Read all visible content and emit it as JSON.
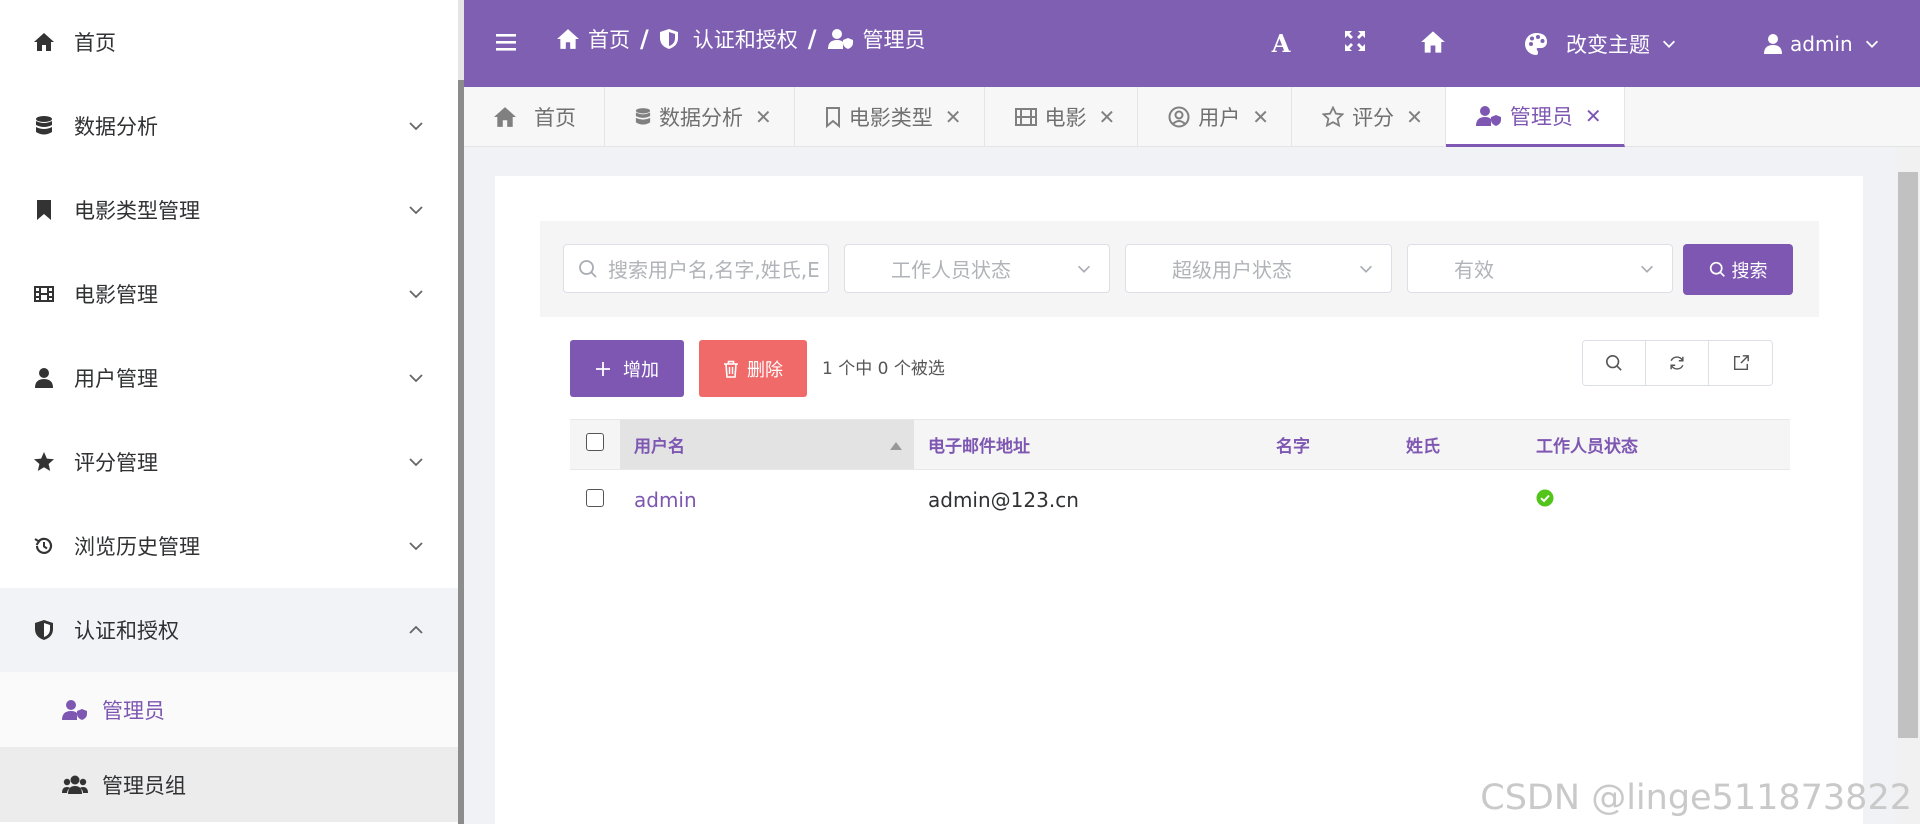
{
  "sidebar": {
    "items": [
      {
        "label": "首页",
        "icon": "home-icon"
      },
      {
        "label": "数据分析",
        "icon": "database-icon"
      },
      {
        "label": "电影类型管理",
        "icon": "bookmark-icon"
      },
      {
        "label": "电影管理",
        "icon": "film-icon"
      },
      {
        "label": "用户管理",
        "icon": "user-icon"
      },
      {
        "label": "评分管理",
        "icon": "star-icon"
      },
      {
        "label": "浏览历史管理",
        "icon": "history-icon"
      },
      {
        "label": "认证和授权",
        "icon": "shield-icon"
      }
    ],
    "subitems": [
      {
        "label": "管理员",
        "icon": "user-shield-icon"
      },
      {
        "label": "管理员组",
        "icon": "users-icon"
      }
    ]
  },
  "header": {
    "breadcrumb": [
      {
        "label": "首页"
      },
      {
        "label": "认证和授权"
      },
      {
        "label": "管理员"
      }
    ],
    "separator": "/",
    "font_tool": "A",
    "theme_label": "改变主题",
    "user_label": "admin"
  },
  "tabs": [
    {
      "label": "首页",
      "closable": false
    },
    {
      "label": "数据分析",
      "closable": true
    },
    {
      "label": "电影类型",
      "closable": true
    },
    {
      "label": "电影",
      "closable": true
    },
    {
      "label": "用户",
      "closable": true
    },
    {
      "label": "评分",
      "closable": true
    },
    {
      "label": "管理员",
      "closable": true,
      "active": true
    }
  ],
  "filters": {
    "search_placeholder": "搜索用户名,名字,姓氏,E",
    "staff_status": "工作人员状态",
    "superuser_status": "超级用户状态",
    "active_status": "有效",
    "search_button": "搜索"
  },
  "actions": {
    "add_label": "增加",
    "delete_label": "删除",
    "selection_text": "1 个中 0 个被选"
  },
  "table": {
    "columns": [
      "用户名",
      "电子邮件地址",
      "名字",
      "姓氏",
      "工作人员状态"
    ],
    "rows": [
      {
        "username": "admin",
        "email": "admin@123.cn",
        "first_name": "",
        "last_name": "",
        "is_staff": true
      }
    ]
  },
  "watermark": "CSDN @linge511873822",
  "colors": {
    "accent": "#7e57b2",
    "header": "#7e5fb1",
    "danger": "#f06a6a",
    "success": "#52c41a"
  }
}
